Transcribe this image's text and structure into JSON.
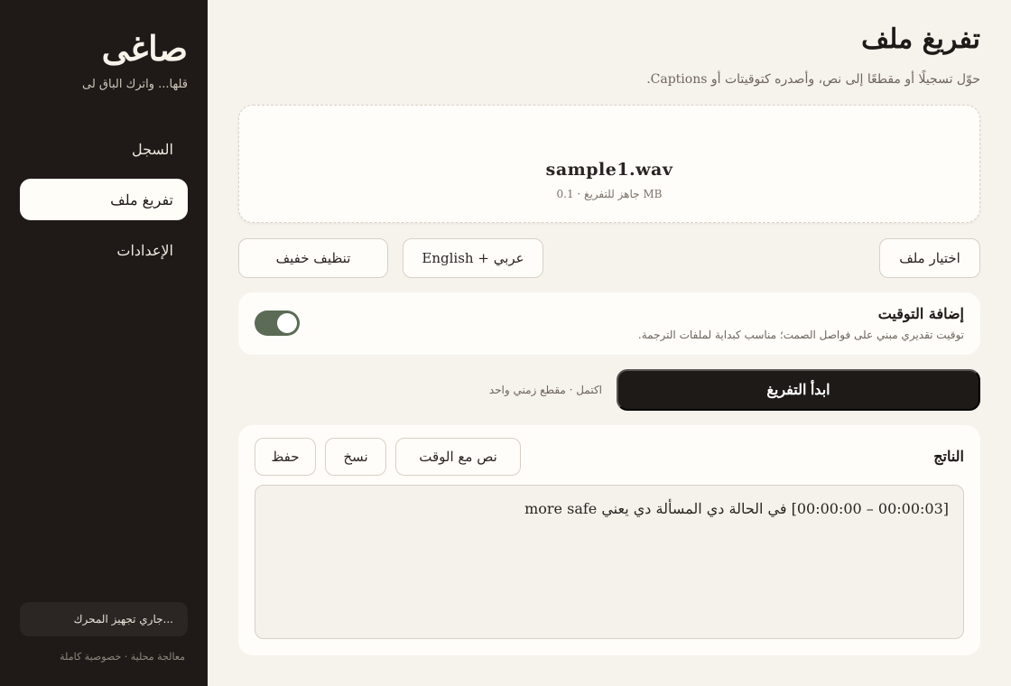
{
  "sidebar": {
    "brand": "صاغى",
    "tagline": "قلها... واترك الباق لى",
    "items": [
      {
        "label": "السجل"
      },
      {
        "label": "تفريغ ملف"
      },
      {
        "label": "الإعدادات"
      }
    ],
    "engine_status": "جاري تجهيز المحرك...",
    "privacy_note": "معالجة محلية · خصوصية كاملة"
  },
  "header": {
    "title": "تفريغ ملف",
    "subtitle": "حوّل تسجيلًا أو مقطعًا إلى نص، وأصدره كتوقيتات أو Captions."
  },
  "file": {
    "name": "sample1.wav",
    "meta": "جاهز للتفريغ · 0.1 MB"
  },
  "controls": {
    "choose_file": "اختيار ملف",
    "language": "English + عربي",
    "cleanup": "تنظيف خفيف"
  },
  "timing": {
    "title": "إضافة التوقيت",
    "description": "توقيت تقديري مبني على فواصل الصمت؛ مناسب كبداية لملفات الترجمة.",
    "enabled": true
  },
  "action": {
    "start": "ابدأ التفريغ",
    "status": "اكتمل · مقطع زمني واحد"
  },
  "output": {
    "title": "الناتج",
    "format": "نص مع الوقت",
    "copy": "نسخ",
    "save": "حفظ",
    "text": "[00:00:03 – 00:00:00] في الحالة دي المسألة دي يعني more safe"
  },
  "colors": {
    "sidebar_bg": "#1f1a18",
    "page_bg": "#f6f2ec",
    "accent_toggle": "#5c6b56",
    "primary_button": "#1e1a18"
  }
}
